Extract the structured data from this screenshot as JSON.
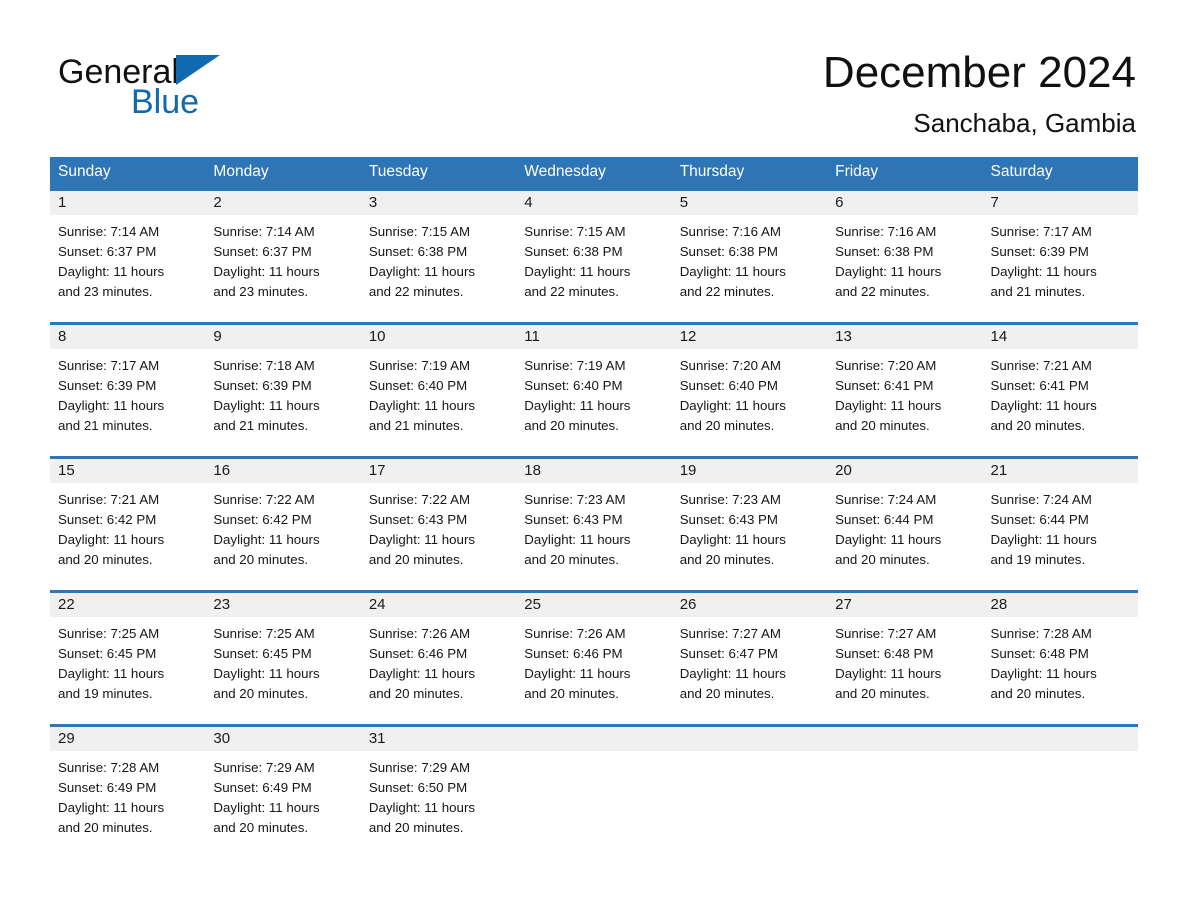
{
  "brand": {
    "word1": "General",
    "word2": "Blue",
    "triangle_color": "#1169b0",
    "icon": "triangle-logo-icon"
  },
  "header": {
    "month_title": "December 2024",
    "location": "Sanchaba, Gambia"
  },
  "theme": {
    "header_blue": "#2e75b6",
    "row_divider_blue": "#2e75b6",
    "daynum_band": "#f0f0f0",
    "text": "#161616"
  },
  "weekdays": [
    "Sunday",
    "Monday",
    "Tuesday",
    "Wednesday",
    "Thursday",
    "Friday",
    "Saturday"
  ],
  "weeks": [
    [
      {
        "day": "1",
        "sunrise": "Sunrise: 7:14 AM",
        "sunset": "Sunset: 6:37 PM",
        "daylight1": "Daylight: 11 hours",
        "daylight2": "and 23 minutes."
      },
      {
        "day": "2",
        "sunrise": "Sunrise: 7:14 AM",
        "sunset": "Sunset: 6:37 PM",
        "daylight1": "Daylight: 11 hours",
        "daylight2": "and 23 minutes."
      },
      {
        "day": "3",
        "sunrise": "Sunrise: 7:15 AM",
        "sunset": "Sunset: 6:38 PM",
        "daylight1": "Daylight: 11 hours",
        "daylight2": "and 22 minutes."
      },
      {
        "day": "4",
        "sunrise": "Sunrise: 7:15 AM",
        "sunset": "Sunset: 6:38 PM",
        "daylight1": "Daylight: 11 hours",
        "daylight2": "and 22 minutes."
      },
      {
        "day": "5",
        "sunrise": "Sunrise: 7:16 AM",
        "sunset": "Sunset: 6:38 PM",
        "daylight1": "Daylight: 11 hours",
        "daylight2": "and 22 minutes."
      },
      {
        "day": "6",
        "sunrise": "Sunrise: 7:16 AM",
        "sunset": "Sunset: 6:38 PM",
        "daylight1": "Daylight: 11 hours",
        "daylight2": "and 22 minutes."
      },
      {
        "day": "7",
        "sunrise": "Sunrise: 7:17 AM",
        "sunset": "Sunset: 6:39 PM",
        "daylight1": "Daylight: 11 hours",
        "daylight2": "and 21 minutes."
      }
    ],
    [
      {
        "day": "8",
        "sunrise": "Sunrise: 7:17 AM",
        "sunset": "Sunset: 6:39 PM",
        "daylight1": "Daylight: 11 hours",
        "daylight2": "and 21 minutes."
      },
      {
        "day": "9",
        "sunrise": "Sunrise: 7:18 AM",
        "sunset": "Sunset: 6:39 PM",
        "daylight1": "Daylight: 11 hours",
        "daylight2": "and 21 minutes."
      },
      {
        "day": "10",
        "sunrise": "Sunrise: 7:19 AM",
        "sunset": "Sunset: 6:40 PM",
        "daylight1": "Daylight: 11 hours",
        "daylight2": "and 21 minutes."
      },
      {
        "day": "11",
        "sunrise": "Sunrise: 7:19 AM",
        "sunset": "Sunset: 6:40 PM",
        "daylight1": "Daylight: 11 hours",
        "daylight2": "and 20 minutes."
      },
      {
        "day": "12",
        "sunrise": "Sunrise: 7:20 AM",
        "sunset": "Sunset: 6:40 PM",
        "daylight1": "Daylight: 11 hours",
        "daylight2": "and 20 minutes."
      },
      {
        "day": "13",
        "sunrise": "Sunrise: 7:20 AM",
        "sunset": "Sunset: 6:41 PM",
        "daylight1": "Daylight: 11 hours",
        "daylight2": "and 20 minutes."
      },
      {
        "day": "14",
        "sunrise": "Sunrise: 7:21 AM",
        "sunset": "Sunset: 6:41 PM",
        "daylight1": "Daylight: 11 hours",
        "daylight2": "and 20 minutes."
      }
    ],
    [
      {
        "day": "15",
        "sunrise": "Sunrise: 7:21 AM",
        "sunset": "Sunset: 6:42 PM",
        "daylight1": "Daylight: 11 hours",
        "daylight2": "and 20 minutes."
      },
      {
        "day": "16",
        "sunrise": "Sunrise: 7:22 AM",
        "sunset": "Sunset: 6:42 PM",
        "daylight1": "Daylight: 11 hours",
        "daylight2": "and 20 minutes."
      },
      {
        "day": "17",
        "sunrise": "Sunrise: 7:22 AM",
        "sunset": "Sunset: 6:43 PM",
        "daylight1": "Daylight: 11 hours",
        "daylight2": "and 20 minutes."
      },
      {
        "day": "18",
        "sunrise": "Sunrise: 7:23 AM",
        "sunset": "Sunset: 6:43 PM",
        "daylight1": "Daylight: 11 hours",
        "daylight2": "and 20 minutes."
      },
      {
        "day": "19",
        "sunrise": "Sunrise: 7:23 AM",
        "sunset": "Sunset: 6:43 PM",
        "daylight1": "Daylight: 11 hours",
        "daylight2": "and 20 minutes."
      },
      {
        "day": "20",
        "sunrise": "Sunrise: 7:24 AM",
        "sunset": "Sunset: 6:44 PM",
        "daylight1": "Daylight: 11 hours",
        "daylight2": "and 20 minutes."
      },
      {
        "day": "21",
        "sunrise": "Sunrise: 7:24 AM",
        "sunset": "Sunset: 6:44 PM",
        "daylight1": "Daylight: 11 hours",
        "daylight2": "and 19 minutes."
      }
    ],
    [
      {
        "day": "22",
        "sunrise": "Sunrise: 7:25 AM",
        "sunset": "Sunset: 6:45 PM",
        "daylight1": "Daylight: 11 hours",
        "daylight2": "and 19 minutes."
      },
      {
        "day": "23",
        "sunrise": "Sunrise: 7:25 AM",
        "sunset": "Sunset: 6:45 PM",
        "daylight1": "Daylight: 11 hours",
        "daylight2": "and 20 minutes."
      },
      {
        "day": "24",
        "sunrise": "Sunrise: 7:26 AM",
        "sunset": "Sunset: 6:46 PM",
        "daylight1": "Daylight: 11 hours",
        "daylight2": "and 20 minutes."
      },
      {
        "day": "25",
        "sunrise": "Sunrise: 7:26 AM",
        "sunset": "Sunset: 6:46 PM",
        "daylight1": "Daylight: 11 hours",
        "daylight2": "and 20 minutes."
      },
      {
        "day": "26",
        "sunrise": "Sunrise: 7:27 AM",
        "sunset": "Sunset: 6:47 PM",
        "daylight1": "Daylight: 11 hours",
        "daylight2": "and 20 minutes."
      },
      {
        "day": "27",
        "sunrise": "Sunrise: 7:27 AM",
        "sunset": "Sunset: 6:48 PM",
        "daylight1": "Daylight: 11 hours",
        "daylight2": "and 20 minutes."
      },
      {
        "day": "28",
        "sunrise": "Sunrise: 7:28 AM",
        "sunset": "Sunset: 6:48 PM",
        "daylight1": "Daylight: 11 hours",
        "daylight2": "and 20 minutes."
      }
    ],
    [
      {
        "day": "29",
        "sunrise": "Sunrise: 7:28 AM",
        "sunset": "Sunset: 6:49 PM",
        "daylight1": "Daylight: 11 hours",
        "daylight2": "and 20 minutes."
      },
      {
        "day": "30",
        "sunrise": "Sunrise: 7:29 AM",
        "sunset": "Sunset: 6:49 PM",
        "daylight1": "Daylight: 11 hours",
        "daylight2": "and 20 minutes."
      },
      {
        "day": "31",
        "sunrise": "Sunrise: 7:29 AM",
        "sunset": "Sunset: 6:50 PM",
        "daylight1": "Daylight: 11 hours",
        "daylight2": "and 20 minutes."
      },
      {
        "day": "",
        "sunrise": "",
        "sunset": "",
        "daylight1": "",
        "daylight2": ""
      },
      {
        "day": "",
        "sunrise": "",
        "sunset": "",
        "daylight1": "",
        "daylight2": ""
      },
      {
        "day": "",
        "sunrise": "",
        "sunset": "",
        "daylight1": "",
        "daylight2": ""
      },
      {
        "day": "",
        "sunrise": "",
        "sunset": "",
        "daylight1": "",
        "daylight2": ""
      }
    ]
  ]
}
